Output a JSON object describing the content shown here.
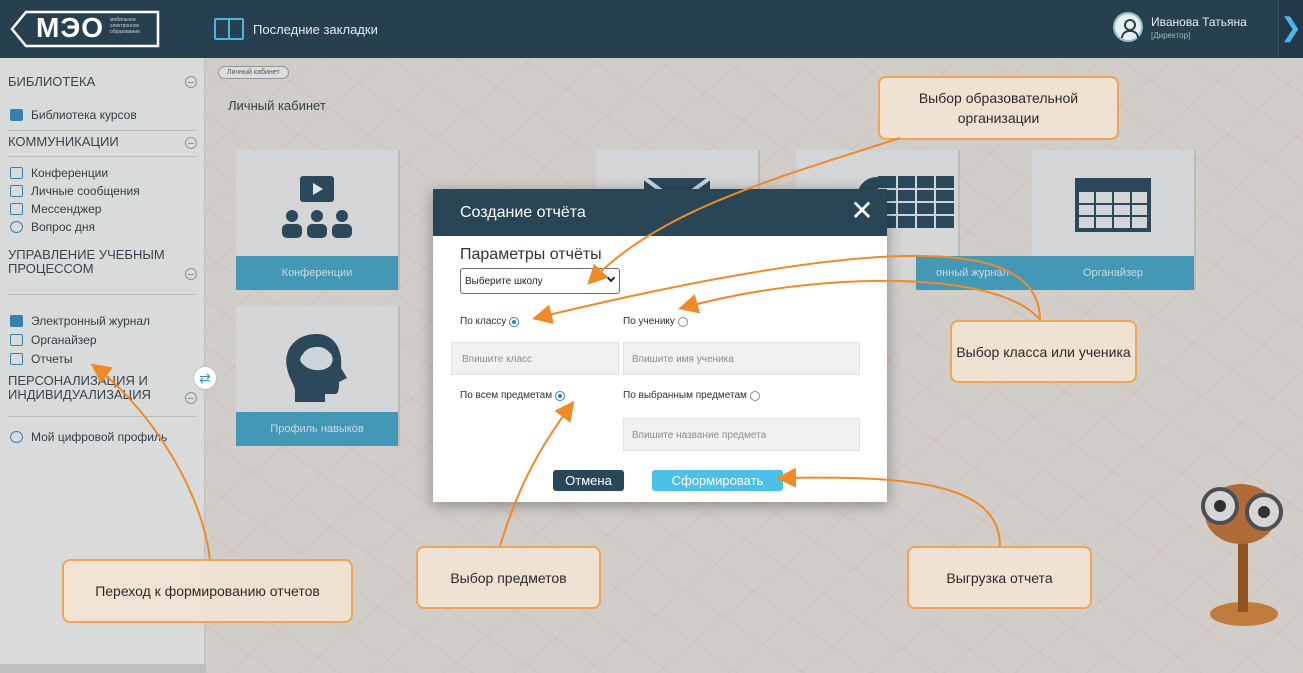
{
  "header": {
    "logo_text": "МЭО",
    "logo_tagline": "мобильное электронное образование",
    "bookmarks_label": "Последние закладки",
    "user_name": "Иванова Татьяна",
    "user_role": "[Директор]",
    "collapse_icon": "chevron-right-icon"
  },
  "sidebar": {
    "sections": [
      {
        "title": "БИБЛИОТЕКА",
        "items": [
          "Библиотека курсов"
        ]
      },
      {
        "title": "КОММУНИКАЦИИ",
        "items": [
          "Конференции",
          "Личные сообщения",
          "Мессенджер",
          "Вопрос дня"
        ]
      },
      {
        "title_line1": "УПРАВЛЕНИЕ УЧЕБНЫМ",
        "title_line2": "ПРОЦЕССОМ",
        "items": [
          "Электронный журнал",
          "Органайзер",
          "Отчеты"
        ]
      },
      {
        "title_line1": "ПЕРСОНАЛИЗАЦИЯ И",
        "title_line2": "ИНДИВИДУАЛИЗАЦИЯ",
        "items": [
          "Мой цифровой профиль"
        ]
      }
    ]
  },
  "main": {
    "breadcrumb": "Личный кабинет",
    "page_title": "Личный кабинет",
    "tiles": [
      "Конференции",
      "Профиль навыков",
      "онный журнал",
      "Органайзер"
    ]
  },
  "modal": {
    "title": "Создание отчёта",
    "params_title": "Параметры отчёты",
    "school_select": "Выберите школу",
    "by_class": "По классу",
    "by_student": "По ученику",
    "class_placeholder": "Впишите класс",
    "student_placeholder": "Впишите имя ученика",
    "all_subjects": "По всем предметам",
    "selected_subjects": "По выбранным предметам",
    "subject_placeholder": "Впишите название предмета",
    "cancel": "Отмена",
    "submit": "Сформировать"
  },
  "callouts": {
    "org": "Выбор образовательной организации",
    "class_student": "Выбор класса или ученика",
    "subjects": "Выбор предметов",
    "export": "Выгрузка отчета",
    "reports": "Переход к формированию отчетов"
  },
  "colors": {
    "accent": "#efa45a",
    "header": "#27404f",
    "tile": "#4aa9c9",
    "submit": "#4cc0e6"
  }
}
